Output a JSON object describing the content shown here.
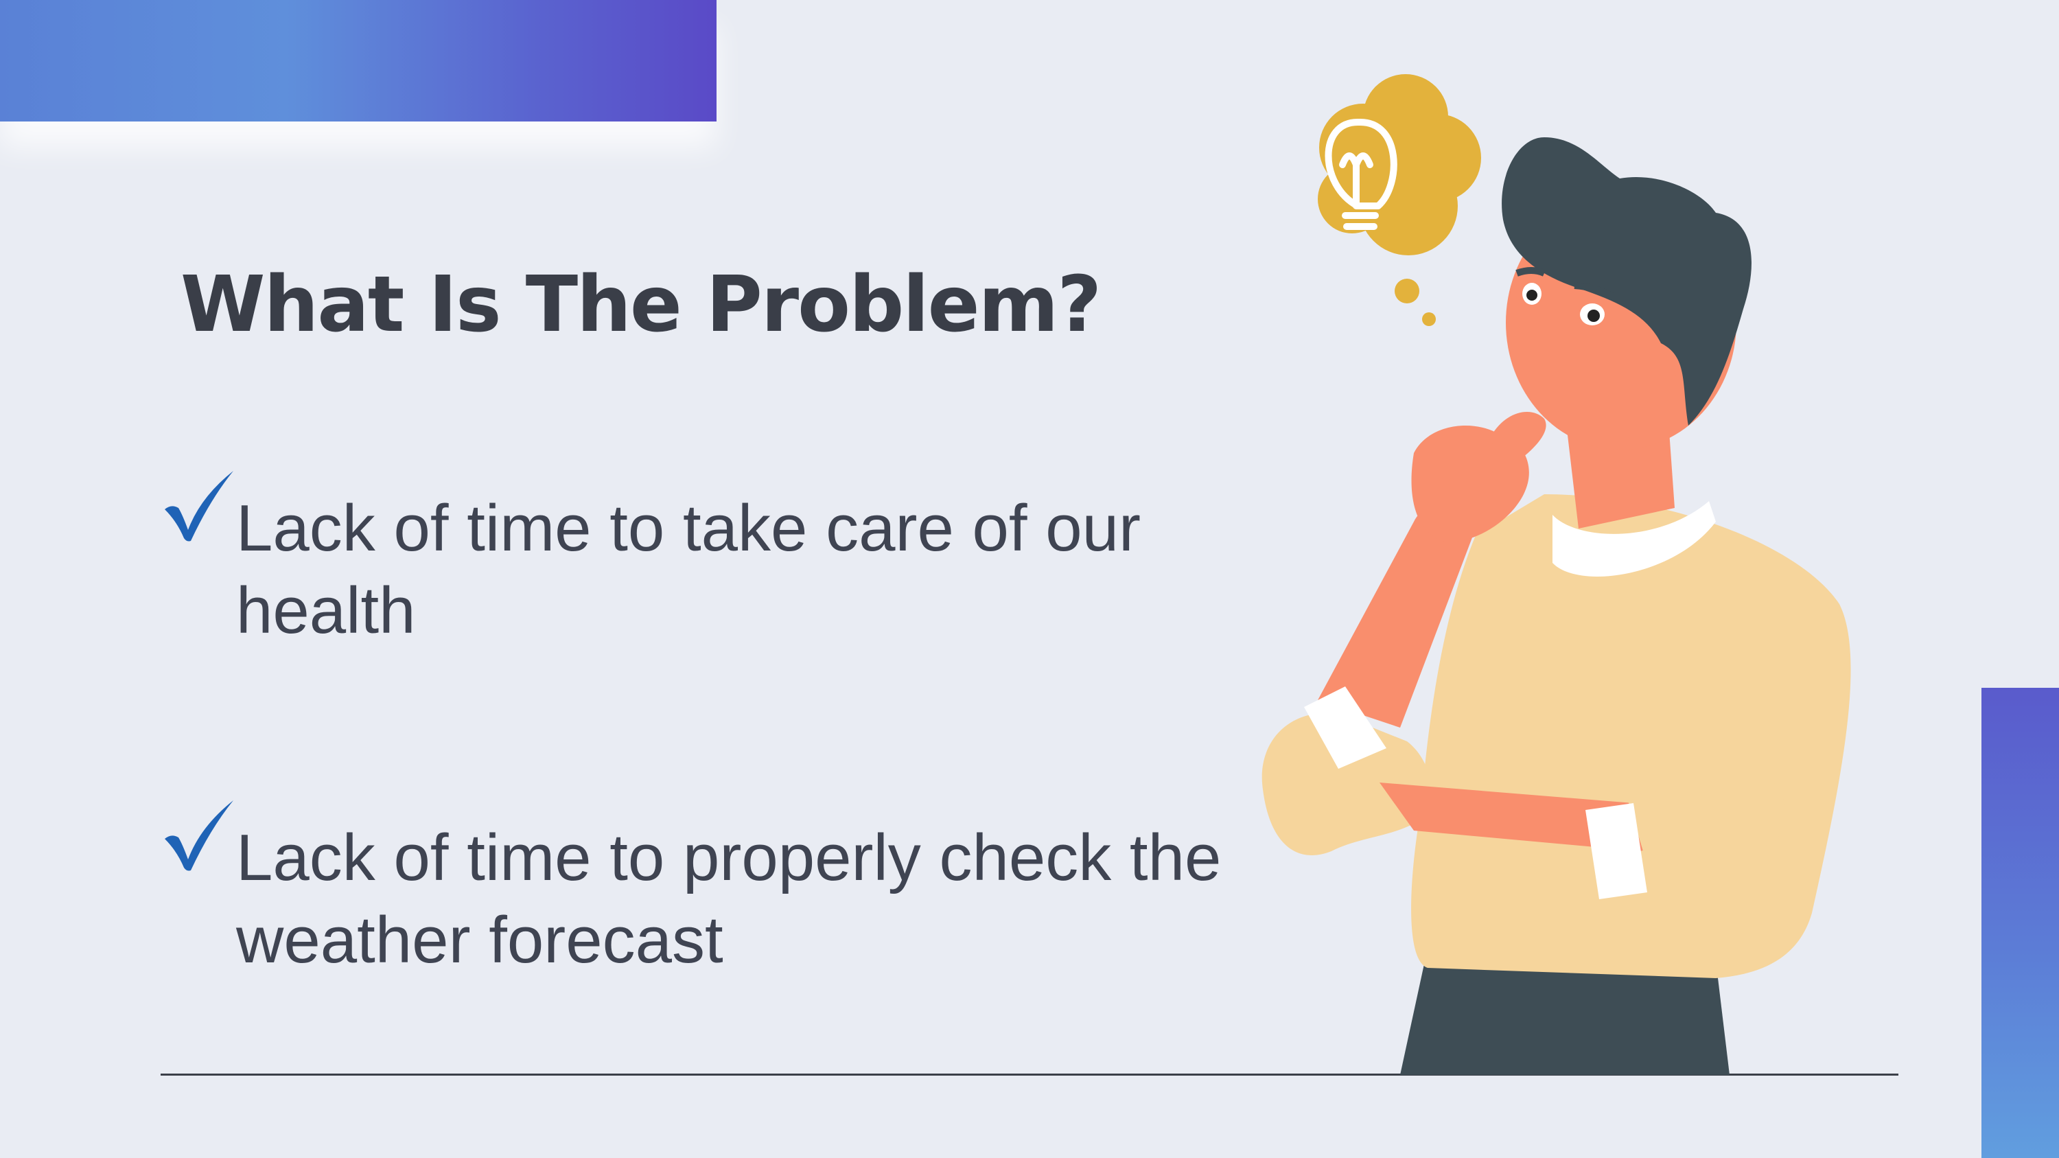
{
  "slide": {
    "title": "What Is The Problem?",
    "bullets": [
      {
        "icon": "checkmark-icon",
        "text": "Lack of time to take care of our health"
      },
      {
        "icon": "checkmark-icon",
        "text": "Lack of time to properly check the weather forecast"
      }
    ],
    "illustration": {
      "icon": "thinking-man-illustration",
      "thought_icon": "lightbulb-icon"
    }
  },
  "colors": {
    "background": "#e9ecf3",
    "title": "#3a3e48",
    "body_text": "#3f4452",
    "checkmark": "#1f63b6",
    "accent_gradient_start": "#5f8fdb",
    "accent_gradient_end": "#5a4ac7",
    "thought_bubble": "#e3b23c",
    "skin": "#f98e6d",
    "sweater": "#f6d59c",
    "hair": "#3e4d55"
  }
}
